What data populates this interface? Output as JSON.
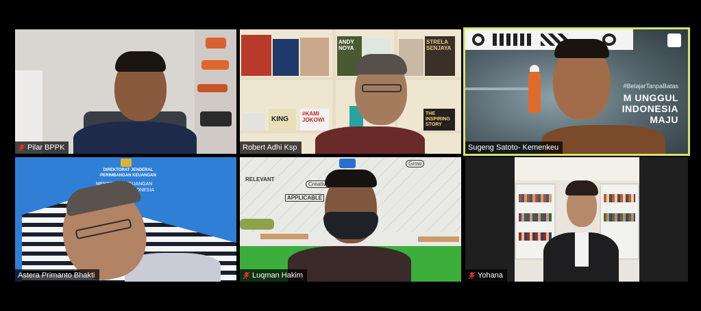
{
  "participants": [
    {
      "name": "Pilar BPPK",
      "muted": true
    },
    {
      "name": "Robert Adhi Ksp",
      "muted": false
    },
    {
      "name": "Sugeng Satoto- Kemenkeu",
      "muted": false,
      "active_speaker": true
    },
    {
      "name": "Astera Primanto Bhakti",
      "muted": false
    },
    {
      "name": "Luqman Hakim",
      "muted": true
    },
    {
      "name": "Yohana",
      "muted": true
    }
  ],
  "backgrounds": {
    "sugeng_tag": "#BelajarTanpaBatas",
    "sugeng_line1": "M UNGGUL",
    "sugeng_line2": "INDONESIA",
    "sugeng_line3": "MAJU",
    "astera_line1": "DIREKTORAT JENDERAL",
    "astera_line2": "PERIMBANGAN KEUANGAN",
    "astera_line3": "MENTERIAN KEUANGAN",
    "astera_line4": "REPUBLIK INDONESIA",
    "book_king": "KING",
    "book_jokowi": "#KAMI JOKOWI",
    "book_story": "THE INSPIRING STORY",
    "book_andy": "ANDY NOYA",
    "book_strela": "STRELA SENJAYA",
    "doodle_applicable": "APPLICABLE",
    "doodle_creative": "Creative",
    "doodle_grow": "Grow",
    "doodle_relevant": "RELEVANT"
  },
  "colors": {
    "active_border": "#d8e46a",
    "mic_muted": "#e0322a"
  }
}
